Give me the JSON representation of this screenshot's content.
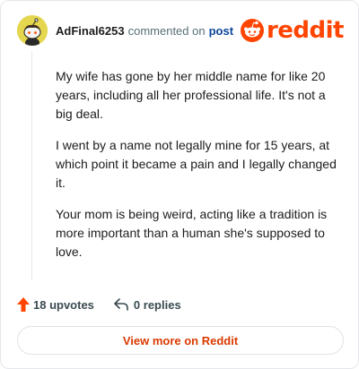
{
  "header": {
    "username": "AdFinal6253",
    "action_text": "commented on",
    "post_link": "post",
    "logo_text": "reddit"
  },
  "comment": {
    "paragraphs": [
      "My wife has gone by her middle name for like 20 years, including all her professional life. It's not a big deal.",
      "I went by a name not legally mine for 15 years, at which point it became a pain and I legally changed it.",
      "Your mom is being weird, acting like a tradition is more important than a human she's supposed to love."
    ]
  },
  "footer": {
    "upvotes_label": "18 upvotes",
    "replies_label": "0 replies"
  },
  "view_more_label": "View more on Reddit",
  "colors": {
    "brand": "#ff4500",
    "link": "#0a449b",
    "view_more": "#d93a00",
    "avatar_bg": "#e5d64f"
  },
  "icons": {
    "avatar": "snoo-avatar-icon",
    "logo": "reddit-snoo-icon",
    "upvote": "upvote-arrow-icon",
    "reply": "reply-arrow-icon"
  }
}
